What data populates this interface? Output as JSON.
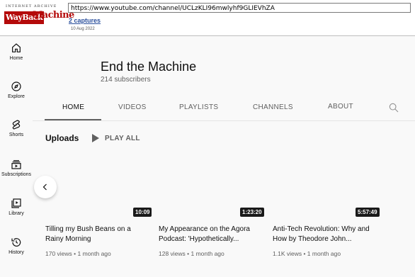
{
  "wayback": {
    "logo_top": "INTERNET ARCHIVE",
    "logo_word1": "WayBack",
    "logo_word2": "Machine",
    "url": "https://www.youtube.com/channel/UCLzKLI96mwlyhf9GLIEVhZA",
    "captures": "2 captures",
    "date": "10 Aug 2022"
  },
  "nav": {
    "items": [
      {
        "label": "Home",
        "icon": "home-icon"
      },
      {
        "label": "Explore",
        "icon": "compass-icon"
      },
      {
        "label": "Shorts",
        "icon": "shorts-icon"
      },
      {
        "label": "Subscriptions",
        "icon": "subscriptions-icon"
      },
      {
        "label": "Library",
        "icon": "library-icon"
      },
      {
        "label": "History",
        "icon": "history-icon"
      }
    ]
  },
  "channel": {
    "name": "End the Machine",
    "subscribers": "214 subscribers"
  },
  "tabs": [
    "HOME",
    "VIDEOS",
    "PLAYLISTS",
    "CHANNELS",
    "ABOUT"
  ],
  "uploads": {
    "heading": "Uploads",
    "play_all": "PLAY ALL"
  },
  "videos": [
    {
      "duration": "10:09",
      "title": "Tilling my Bush Beans on a Rainy Morning",
      "meta": "170 views • 1 month ago"
    },
    {
      "duration": "1:23:20",
      "title": "My Appearance on the Agora Podcast: 'Hypothetically...",
      "meta": "128 views • 1 month ago"
    },
    {
      "duration": "5:57:49",
      "title": "Anti-Tech Revolution: Why and How by Theodore John...",
      "meta": "1.1K views • 1 month ago"
    }
  ]
}
